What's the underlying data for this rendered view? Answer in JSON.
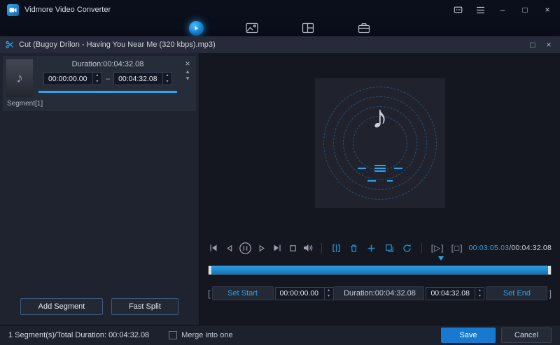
{
  "titlebar": {
    "title": "Vidmore Video Converter"
  },
  "dialog": {
    "title": "Cut (Bugoy Drilon - Having You Near Me (320 kbps).mp3)"
  },
  "segment_panel": {
    "duration": "Duration:00:04:32.08",
    "start_value": "00:00:00.00",
    "range_dash": "–",
    "end_value": "00:04:32.08",
    "segment_label": "Segment[1]",
    "add_segment_label": "Add Segment",
    "fast_split_label": "Fast Split"
  },
  "player": {
    "current_time": "00:03:05.03",
    "time_separator": "/",
    "total_time": "00:04:32.08"
  },
  "trim": {
    "set_start_label": "Set Start",
    "start_value": "00:00:00.00",
    "duration_label": "Duration:00:04:32.08",
    "end_value": "00:04:32.08",
    "set_end_label": "Set End"
  },
  "statusbar": {
    "summary": "1 Segment(s)/Total Duration: 00:04:32.08",
    "merge_label": "Merge into one",
    "save_label": "Save",
    "cancel_label": "Cancel"
  },
  "icons": {
    "minimize": "–",
    "maximize": "□",
    "close": "×",
    "remove_segment": "×",
    "move_up": "▴",
    "move_down": "▾",
    "spin_up": "▴",
    "spin_down": "▾",
    "music_note": "♪",
    "play_segment": "[▷]",
    "stop_segment": "[□]",
    "left_bracket": "[",
    "right_bracket": "]"
  },
  "colors": {
    "accent_blue": "#2aa3e8",
    "timeline_blue": "#1583cc",
    "save_button": "#1779d0"
  }
}
